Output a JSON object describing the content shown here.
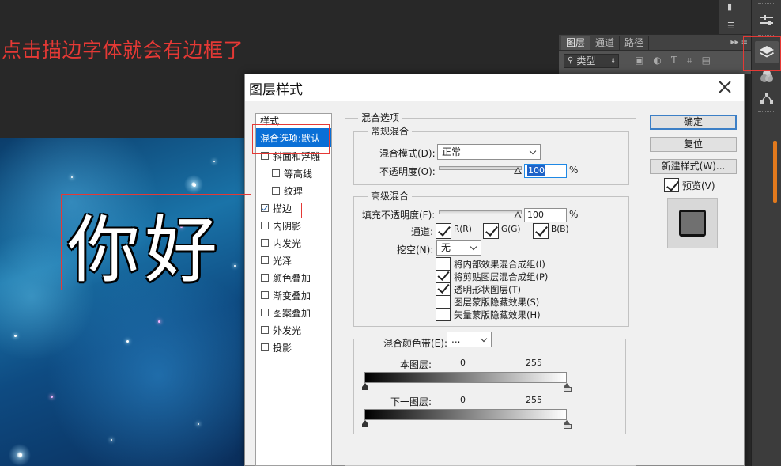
{
  "annotation": {
    "instruction": "点击描边字体就会有边框了",
    "canvas_text": "你好"
  },
  "layers_panel": {
    "tabs": [
      "图层",
      "通道",
      "路径"
    ],
    "filter_label": "类型",
    "menu_glyph": "▸▸ ≡"
  },
  "dialog": {
    "title": "图层样式",
    "styles_header": "样式",
    "styles": [
      {
        "label": "混合选项:默认",
        "checked": null,
        "selected": true,
        "sub": false
      },
      {
        "label": "斜面和浮雕",
        "checked": false,
        "selected": false,
        "sub": false
      },
      {
        "label": "等高线",
        "checked": false,
        "selected": false,
        "sub": true
      },
      {
        "label": "纹理",
        "checked": false,
        "selected": false,
        "sub": true
      },
      {
        "label": "描边",
        "checked": true,
        "selected": false,
        "sub": false
      },
      {
        "label": "内阴影",
        "checked": false,
        "selected": false,
        "sub": false
      },
      {
        "label": "内发光",
        "checked": false,
        "selected": false,
        "sub": false
      },
      {
        "label": "光泽",
        "checked": false,
        "selected": false,
        "sub": false
      },
      {
        "label": "颜色叠加",
        "checked": false,
        "selected": false,
        "sub": false
      },
      {
        "label": "渐变叠加",
        "checked": false,
        "selected": false,
        "sub": false
      },
      {
        "label": "图案叠加",
        "checked": false,
        "selected": false,
        "sub": false
      },
      {
        "label": "外发光",
        "checked": false,
        "selected": false,
        "sub": false
      },
      {
        "label": "投影",
        "checked": false,
        "selected": false,
        "sub": false
      }
    ],
    "blend_options": {
      "legend": "混合选项",
      "general": {
        "legend": "常规混合",
        "mode_label": "混合模式(D):",
        "mode_value": "正常",
        "opacity_label": "不透明度(O):",
        "opacity_value": "100",
        "opacity_unit": "%"
      },
      "advanced": {
        "legend": "高级混合",
        "fill_label": "填充不透明度(F):",
        "fill_value": "100",
        "fill_unit": "%",
        "channels_label": "通道:",
        "channels": [
          {
            "label": "R(R)",
            "checked": true
          },
          {
            "label": "G(G)",
            "checked": true
          },
          {
            "label": "B(B)",
            "checked": true
          }
        ],
        "knockout_label": "挖空(N):",
        "knockout_value": "无",
        "options": [
          {
            "label": "将内部效果混合成组(I)",
            "checked": false
          },
          {
            "label": "将剪贴图层混合成组(P)",
            "checked": true
          },
          {
            "label": "透明形状图层(T)",
            "checked": true
          },
          {
            "label": "图层蒙版隐藏效果(S)",
            "checked": false
          },
          {
            "label": "矢量蒙版隐藏效果(H)",
            "checked": false
          }
        ]
      },
      "blend_if": {
        "legend": "混合颜色带(E):",
        "value": "...",
        "this_layer_label": "本图层:",
        "this_layer_low": "0",
        "this_layer_high": "255",
        "under_layer_label": "下一图层:",
        "under_layer_low": "0",
        "under_layer_high": "255"
      }
    },
    "buttons": {
      "ok": "确定",
      "reset": "复位",
      "new_style": "新建样式(W)...",
      "preview_label": "预览(V)",
      "preview_checked": true
    }
  }
}
